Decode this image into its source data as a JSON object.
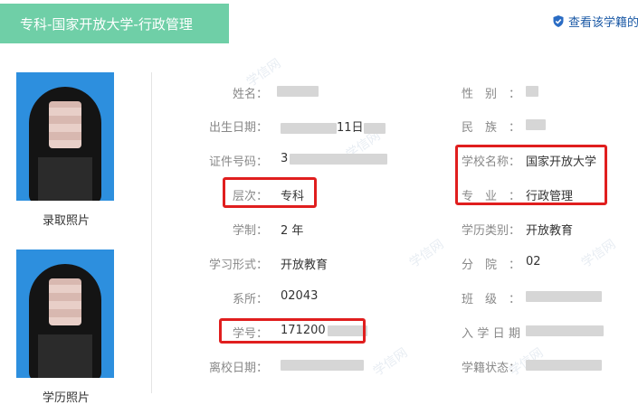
{
  "header": {
    "title": "专科-国家开放大学-行政管理",
    "verify_link": "查看该学籍的"
  },
  "photos": {
    "admission_label": "录取照片",
    "degree_label": "学历照片"
  },
  "watermark_text": "学信网",
  "fields": {
    "name": {
      "label": "姓名：",
      "value": ""
    },
    "gender": {
      "label": "性别：",
      "value": ""
    },
    "birth_date": {
      "label": "出生日期：",
      "value": "11日"
    },
    "ethnicity": {
      "label": "民族：",
      "value": ""
    },
    "id_number": {
      "label": "证件号码：",
      "value": "3"
    },
    "school": {
      "label": "学校名称：",
      "value": "国家开放大学"
    },
    "level": {
      "label": "层次：",
      "value": "专科"
    },
    "major": {
      "label": "专业：",
      "value": "行政管理"
    },
    "duration": {
      "label": "学制：",
      "value": "2 年"
    },
    "edu_type": {
      "label": "学历类别：",
      "value": "开放教育"
    },
    "study_form": {
      "label": "学习形式：",
      "value": "开放教育"
    },
    "branch": {
      "label": "分院：",
      "value": "02"
    },
    "department": {
      "label": "系所：",
      "value": "02043"
    },
    "class": {
      "label": "班级：",
      "value": ""
    },
    "student_id": {
      "label": "学号：",
      "value": "171200"
    },
    "enroll_date": {
      "label": "入学日期",
      "value": ""
    },
    "leave_date": {
      "label": "离校日期：",
      "value": ""
    },
    "status": {
      "label": "学籍状态：",
      "value": ""
    }
  },
  "colors": {
    "header_bg": "#6fcfa7",
    "highlight": "#e01e1e",
    "link": "#1c5aa6"
  }
}
